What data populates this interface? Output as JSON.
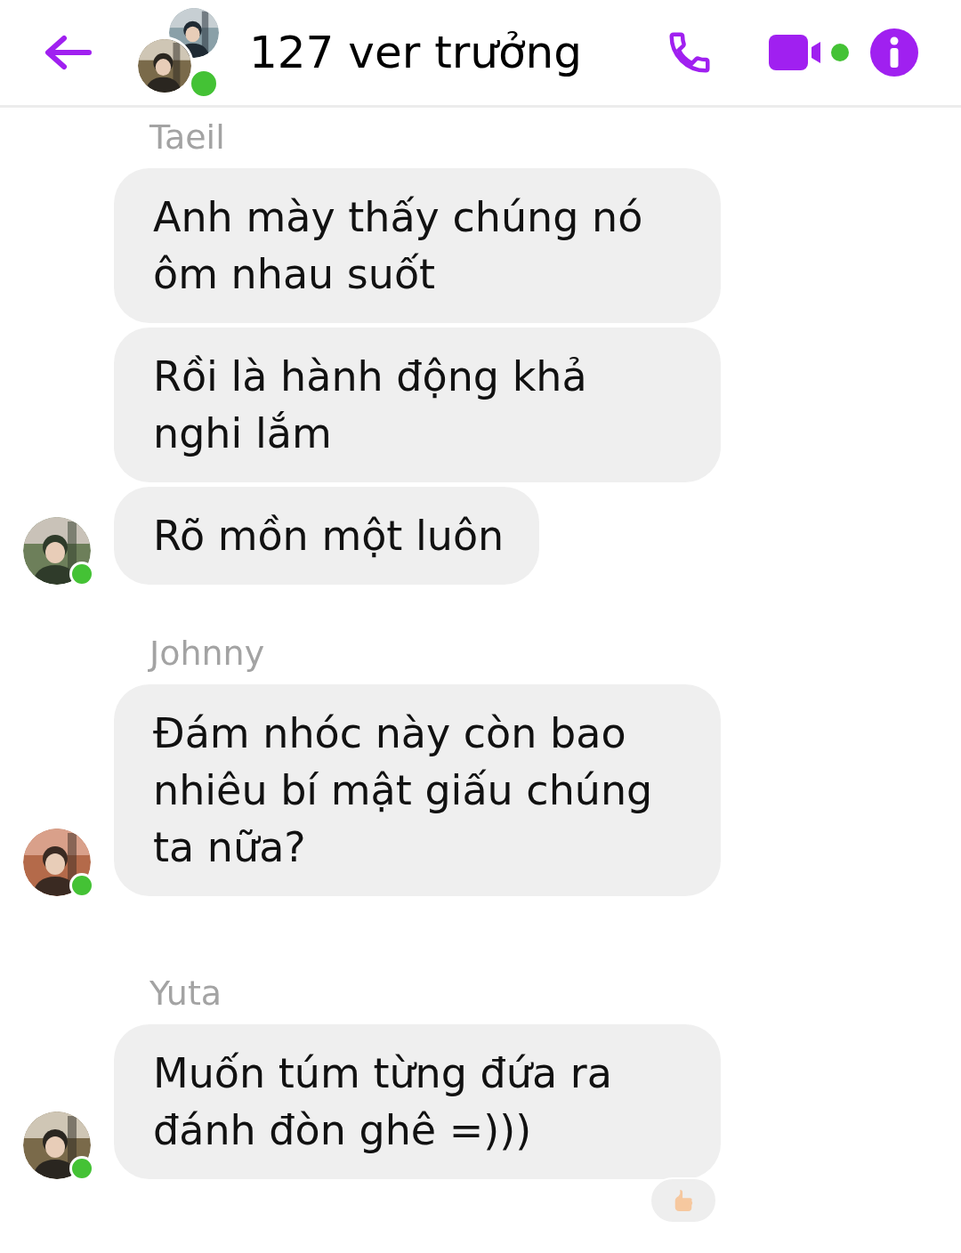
{
  "header": {
    "title": "127 ver trưởng",
    "online": true
  },
  "groups": [
    {
      "sender": "Taeil",
      "online": true,
      "messages": [
        {
          "text": "Anh mày thấy chúng nó ôm nhau suốt"
        },
        {
          "text": "Rồi là hành động khả nghi lắm"
        },
        {
          "text": "Rõ mồn một luôn"
        }
      ]
    },
    {
      "sender": "Johnny",
      "online": true,
      "messages": [
        {
          "text": "Đám nhóc này còn bao nhiêu bí mật giấu chúng ta nữa?"
        }
      ]
    },
    {
      "sender": "Yuta",
      "online": true,
      "messages": [
        {
          "text": "Muốn túm từng đứa ra đánh đòn ghê =)))",
          "liked": true
        }
      ]
    }
  ]
}
